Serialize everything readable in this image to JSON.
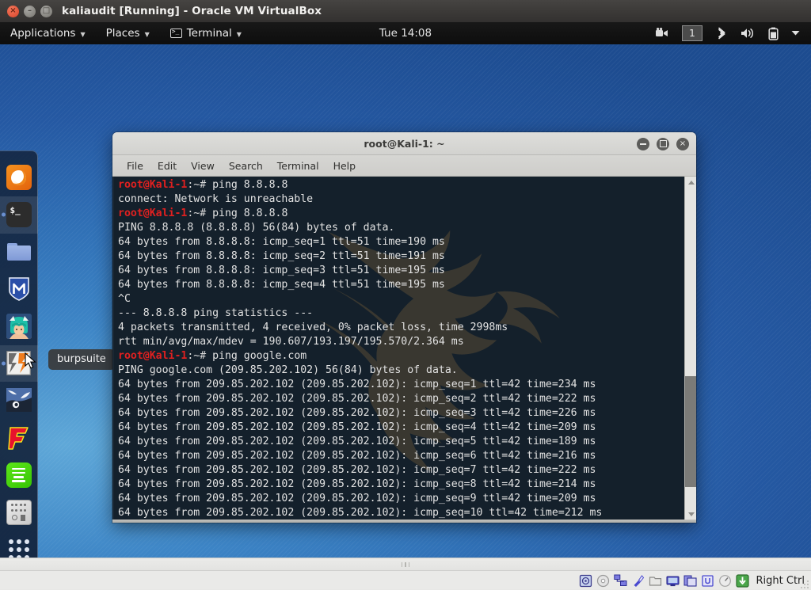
{
  "vbox": {
    "title": "kaliaudit [Running] - Oracle VM VirtualBox",
    "buttons": {
      "close": "×",
      "minimize": "–",
      "maximize": "□"
    },
    "statusbar": {
      "host_key": "Right Ctrl",
      "icons": [
        "harddisk-icon",
        "optical-disk-icon",
        "network-icon",
        "usb-icon",
        "shared-folders-icon",
        "display-icon",
        "recording-icon",
        "virtualization-icon",
        "mouse-integration-icon",
        "host-key-icon"
      ]
    }
  },
  "gnome_panel": {
    "applications": "Applications",
    "places": "Places",
    "active_app": "Terminal",
    "app_icon": "terminal-icon",
    "clock": "Tue 14:08",
    "workspace": "1",
    "tray": [
      "screencast-icon",
      "bluetooth-icon",
      "volume-icon",
      "battery-icon",
      "chevron-down-icon"
    ]
  },
  "dock": {
    "tooltip": "burpsuite",
    "items": [
      {
        "name": "firefox",
        "label": "Firefox ESR",
        "active": false
      },
      {
        "name": "terminal",
        "label": "Terminal",
        "active": true
      },
      {
        "name": "files",
        "label": "Files",
        "active": false
      },
      {
        "name": "metasploit",
        "label": "Metasploit Framework",
        "active": false
      },
      {
        "name": "armitage",
        "label": "Armitage",
        "active": false
      },
      {
        "name": "burpsuite",
        "label": "burpsuite",
        "active": false
      },
      {
        "name": "wireshark",
        "label": "Wireshark",
        "active": false
      },
      {
        "name": "faraday",
        "label": "Faraday",
        "active": false
      },
      {
        "name": "cherrytree",
        "label": "CherryTree",
        "active": false
      },
      {
        "name": "beef",
        "label": "BeEF",
        "active": false
      },
      {
        "name": "show-applications",
        "label": "Show Applications",
        "active": false
      }
    ]
  },
  "terminal": {
    "title": "root@Kali-1: ~",
    "menus": [
      "File",
      "Edit",
      "View",
      "Search",
      "Terminal",
      "Help"
    ],
    "window_buttons": {
      "minimize": "minimize",
      "maximize": "maximize",
      "close": "×"
    },
    "prompt_user": "root@Kali-1",
    "prompt_path": ":~# ",
    "colors": {
      "background": "#14202b",
      "foreground": "#e2e2e2",
      "prompt": "#e02020"
    },
    "lines": [
      {
        "type": "prompt",
        "command": "ping 8.8.8.8"
      },
      {
        "type": "out",
        "text": "connect: Network is unreachable"
      },
      {
        "type": "prompt",
        "command": "ping 8.8.8.8"
      },
      {
        "type": "out",
        "text": "PING 8.8.8.8 (8.8.8.8) 56(84) bytes of data."
      },
      {
        "type": "out",
        "text": "64 bytes from 8.8.8.8: icmp_seq=1 ttl=51 time=190 ms"
      },
      {
        "type": "out",
        "text": "64 bytes from 8.8.8.8: icmp_seq=2 ttl=51 time=191 ms"
      },
      {
        "type": "out",
        "text": "64 bytes from 8.8.8.8: icmp_seq=3 ttl=51 time=195 ms"
      },
      {
        "type": "out",
        "text": "64 bytes from 8.8.8.8: icmp_seq=4 ttl=51 time=195 ms"
      },
      {
        "type": "out",
        "text": "^C"
      },
      {
        "type": "out",
        "text": "--- 8.8.8.8 ping statistics ---"
      },
      {
        "type": "out",
        "text": "4 packets transmitted, 4 received, 0% packet loss, time 2998ms"
      },
      {
        "type": "out",
        "text": "rtt min/avg/max/mdev = 190.607/193.197/195.570/2.364 ms"
      },
      {
        "type": "prompt",
        "command": "ping google.com"
      },
      {
        "type": "out",
        "text": "PING google.com (209.85.202.102) 56(84) bytes of data."
      },
      {
        "type": "out",
        "text": "64 bytes from 209.85.202.102 (209.85.202.102): icmp_seq=1 ttl=42 time=234 ms"
      },
      {
        "type": "out",
        "text": "64 bytes from 209.85.202.102 (209.85.202.102): icmp_seq=2 ttl=42 time=222 ms"
      },
      {
        "type": "out",
        "text": "64 bytes from 209.85.202.102 (209.85.202.102): icmp_seq=3 ttl=42 time=226 ms"
      },
      {
        "type": "out",
        "text": "64 bytes from 209.85.202.102 (209.85.202.102): icmp_seq=4 ttl=42 time=209 ms"
      },
      {
        "type": "out",
        "text": "64 bytes from 209.85.202.102 (209.85.202.102): icmp_seq=5 ttl=42 time=189 ms"
      },
      {
        "type": "out",
        "text": "64 bytes from 209.85.202.102 (209.85.202.102): icmp_seq=6 ttl=42 time=216 ms"
      },
      {
        "type": "out",
        "text": "64 bytes from 209.85.202.102 (209.85.202.102): icmp_seq=7 ttl=42 time=222 ms"
      },
      {
        "type": "out",
        "text": "64 bytes from 209.85.202.102 (209.85.202.102): icmp_seq=8 ttl=42 time=214 ms"
      },
      {
        "type": "out",
        "text": "64 bytes from 209.85.202.102 (209.85.202.102): icmp_seq=9 ttl=42 time=209 ms"
      },
      {
        "type": "out",
        "text": "64 bytes from 209.85.202.102 (209.85.202.102): icmp_seq=10 ttl=42 time=212 ms"
      }
    ]
  }
}
